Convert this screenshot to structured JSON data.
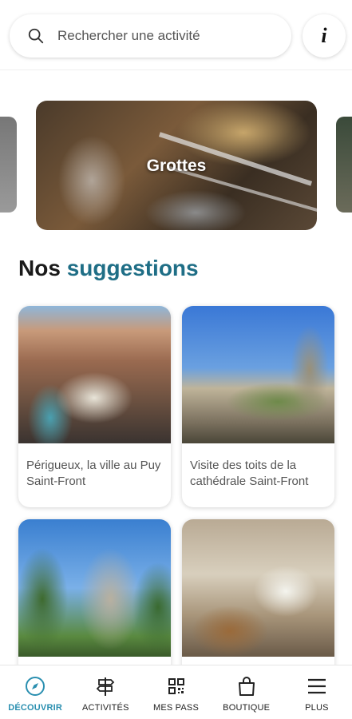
{
  "search": {
    "placeholder": "Rechercher une activité"
  },
  "info_button": {
    "label": "i"
  },
  "carousel": {
    "title": "Grottes"
  },
  "suggestions": {
    "title_part1": "Nos ",
    "title_part2": "suggestions",
    "items": [
      {
        "caption": "Périgueux, la ville au Puy Saint-Front"
      },
      {
        "caption": "Visite des toits de la cathédrale Saint-Front"
      },
      {
        "caption": ""
      },
      {
        "caption": ""
      }
    ]
  },
  "nav": {
    "items": [
      {
        "label": "DÉCOUVRIR",
        "icon": "compass-icon",
        "active": true
      },
      {
        "label": "ACTIVITÉS",
        "icon": "signpost-icon"
      },
      {
        "label": "MES PASS",
        "icon": "qr-code-icon"
      },
      {
        "label": "BOUTIQUE",
        "icon": "shopping-bag-icon"
      },
      {
        "label": "PLUS",
        "icon": "menu-icon"
      }
    ]
  },
  "colors": {
    "accent": "#1f6e86",
    "nav_active": "#2a8fb0"
  }
}
